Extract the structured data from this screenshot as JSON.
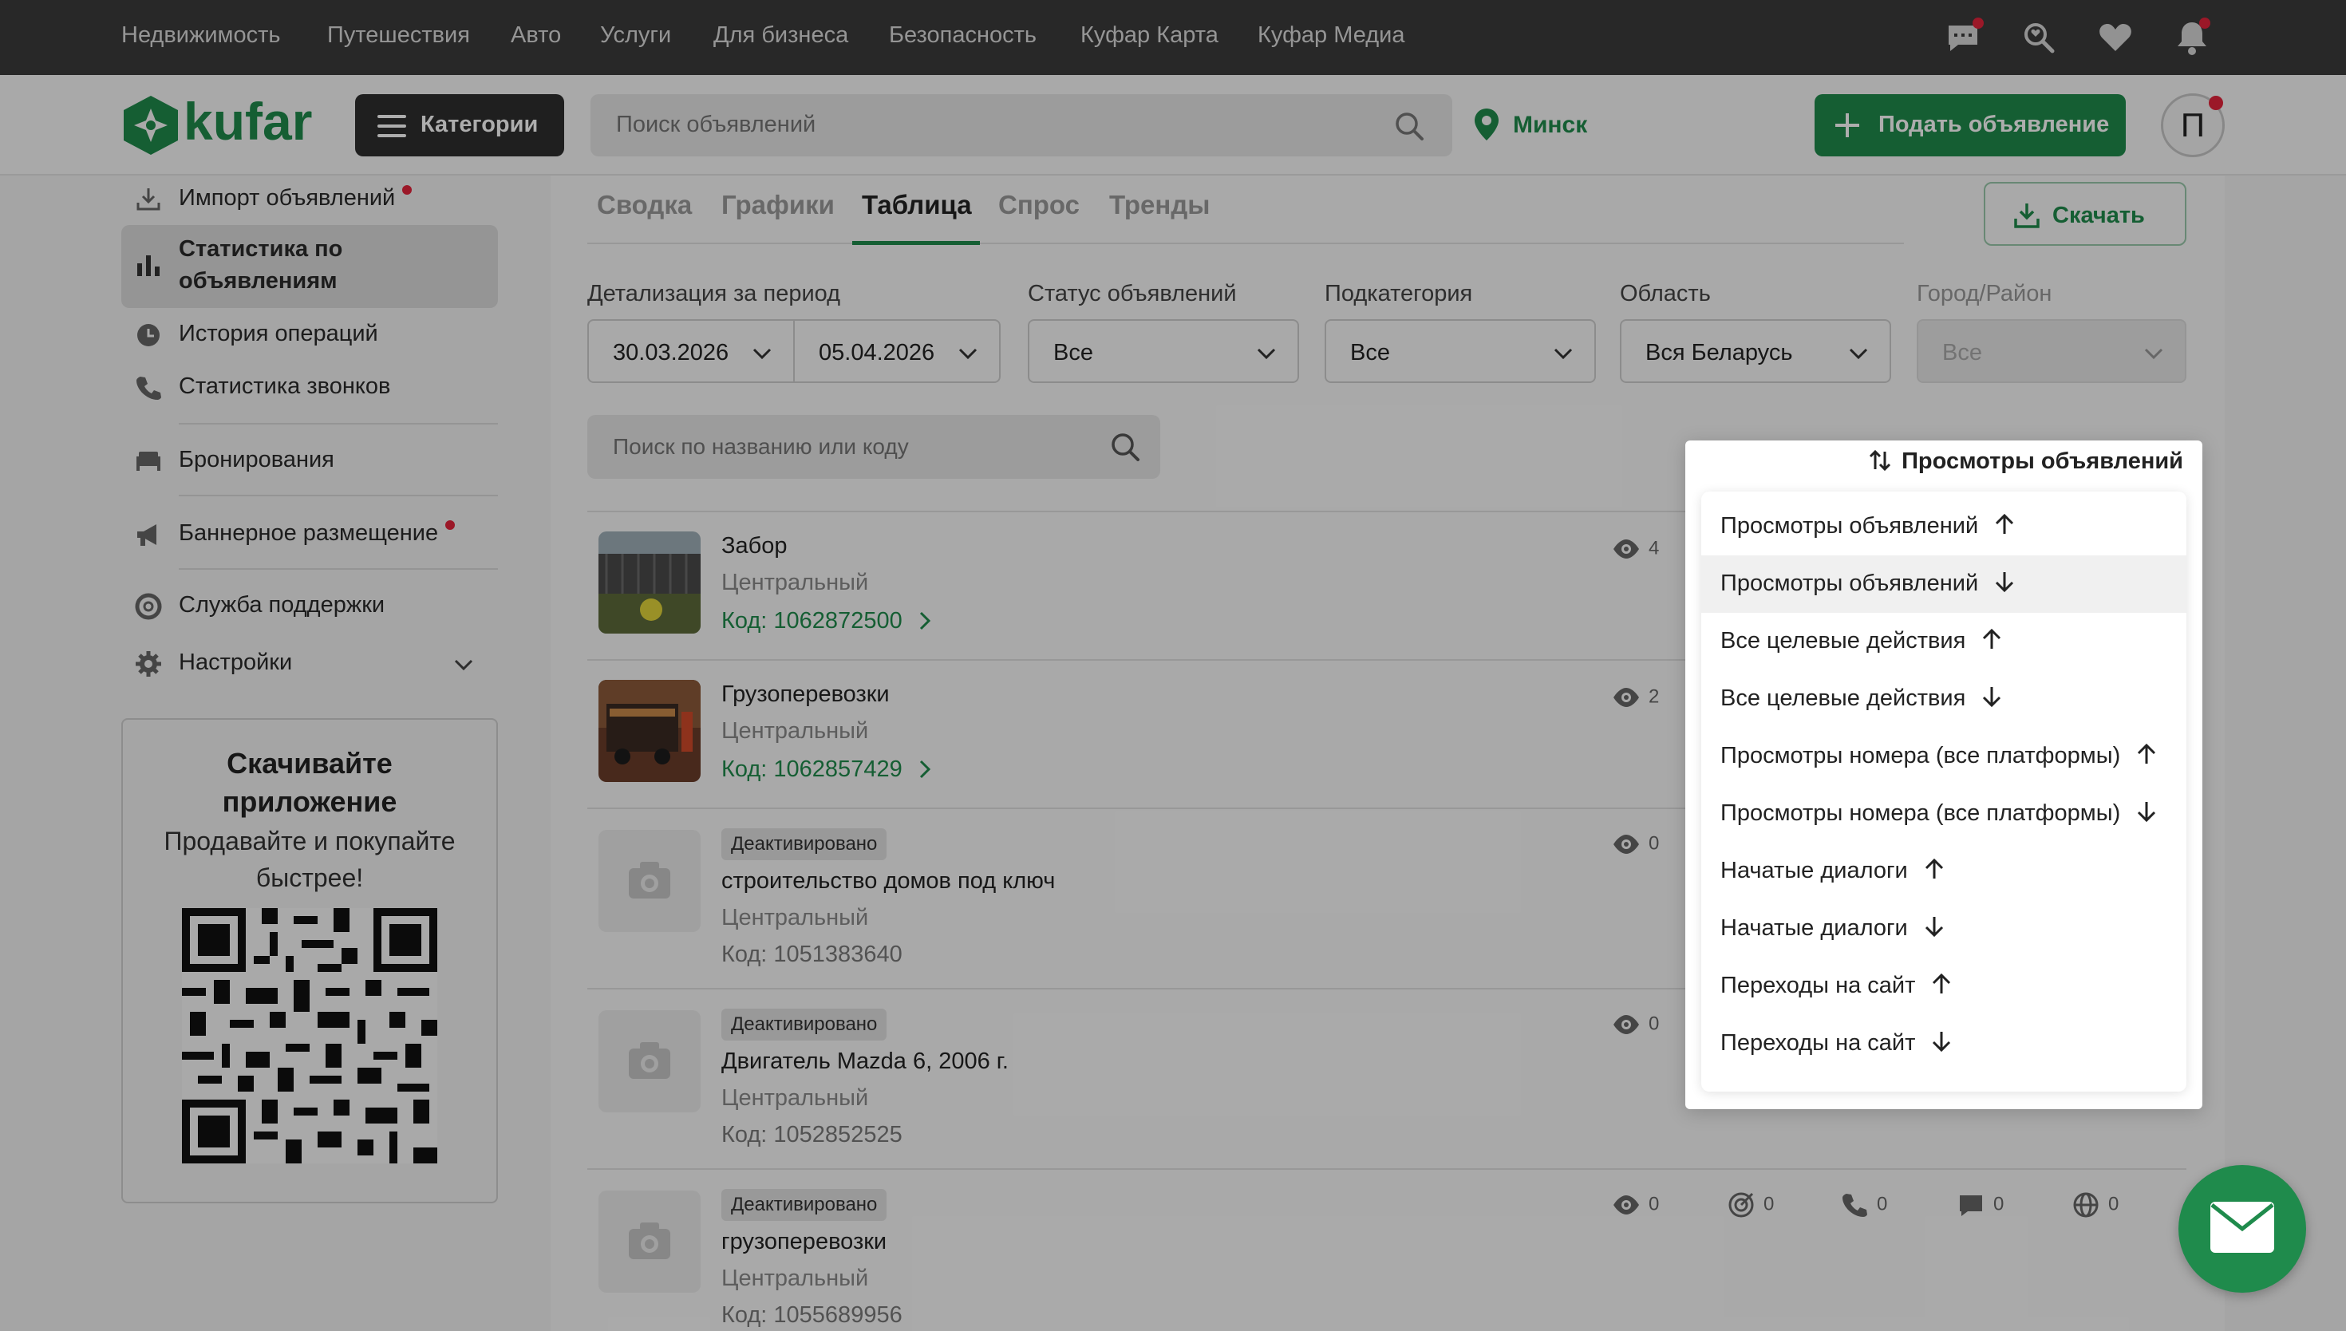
{
  "top_nav": {
    "links": [
      "Недвижимость",
      "Путешествия",
      "Авто",
      "Услуги",
      "Для бизнеса",
      "Безопасность",
      "Куфар Карта",
      "Куфар Медиа"
    ]
  },
  "header": {
    "logo_text": "kufar",
    "categories_label": "Категории",
    "search_placeholder": "Поиск объявлений",
    "location": "Минск",
    "post_ad_label": "Подать объявление",
    "avatar_letter": "П"
  },
  "sidebar": {
    "items": [
      {
        "label": "Импорт объявлений",
        "icon": "import-icon"
      },
      {
        "label": "Статистика по объявлениям",
        "icon": "bar-chart-icon"
      },
      {
        "label": "История операций",
        "icon": "clock-icon"
      },
      {
        "label": "Статистика звонков",
        "icon": "phone-icon"
      },
      {
        "label": "Бронирования",
        "icon": "bed-icon"
      },
      {
        "label": "Баннерное размещение",
        "icon": "megaphone-icon"
      },
      {
        "label": "Служба поддержки",
        "icon": "lifebuoy-icon"
      },
      {
        "label": "Настройки",
        "icon": "gear-icon"
      }
    ],
    "stat_line1": "Статистика по",
    "stat_line2": "объявлениям",
    "promo": {
      "title_line1": "Скачивайте",
      "title_line2": "приложение",
      "subtitle_line1": "Продавайте и покупайте",
      "subtitle_line2": "быстрее!"
    }
  },
  "tabs": [
    "Сводка",
    "Графики",
    "Таблица",
    "Спрос",
    "Тренды"
  ],
  "active_tab": "Таблица",
  "download_label": "Скачать",
  "filters": {
    "period_label": "Детализация за период",
    "date_from": "30.03.2026",
    "date_to": "05.04.2026",
    "status_label": "Статус объявлений",
    "status_value": "Все",
    "subcategory_label": "Подкатегория",
    "subcategory_value": "Все",
    "region_label": "Область",
    "region_value": "Вся Беларусь",
    "city_label": "Город/Район",
    "city_value": "Все"
  },
  "list_search_placeholder": "Поиск по названию или коду",
  "ads": [
    {
      "title": "Забор",
      "region": "Центральный",
      "code": "Код: 1062872500",
      "views": "4",
      "status": ""
    },
    {
      "title": "Грузоперевозки",
      "region": "Центральный",
      "code": "Код: 1062857429",
      "views": "2",
      "status": ""
    },
    {
      "title": "строительство домов под ключ",
      "region": "Центральный",
      "code": "Код: 1051383640",
      "views": "0",
      "status": "Деактивировано"
    },
    {
      "title": "Двигатель Mazda 6, 2006 г.",
      "region": "Центральный",
      "code": "Код: 1052852525",
      "views": "0",
      "status": "Деактивировано"
    },
    {
      "title": "грузоперевозки",
      "region": "Центральный",
      "code": "Код: 1055689956",
      "views": "0",
      "status": "Деактивировано",
      "targets": "0",
      "calls": "0",
      "chats": "0",
      "site": "0"
    }
  ],
  "sort": {
    "current": "Просмотры объявлений",
    "options": [
      {
        "label": "Просмотры объявлений",
        "dir": "up"
      },
      {
        "label": "Просмотры объявлений",
        "dir": "down"
      },
      {
        "label": "Все целевые действия",
        "dir": "up"
      },
      {
        "label": "Все целевые действия",
        "dir": "down"
      },
      {
        "label": "Просмотры номера (все платформы)",
        "dir": "up"
      },
      {
        "label": "Просмотры номера (все платформы)",
        "dir": "down"
      },
      {
        "label": "Начатые диалоги",
        "dir": "up"
      },
      {
        "label": "Начатые диалоги",
        "dir": "down"
      },
      {
        "label": "Переходы на сайт",
        "dir": "up"
      },
      {
        "label": "Переходы на сайт",
        "dir": "down"
      }
    ],
    "highlighted_index": 1
  },
  "colors": {
    "brand": "#1f8b4c",
    "topbar": "#3b3b3b",
    "notify": "#e5243b"
  }
}
